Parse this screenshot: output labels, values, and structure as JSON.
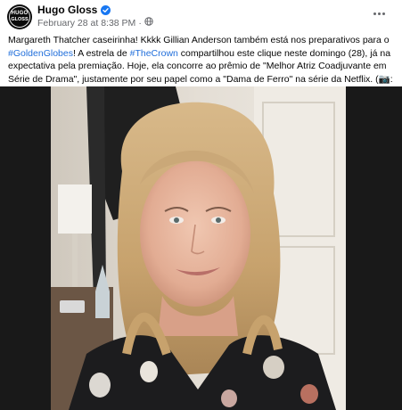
{
  "post": {
    "page_name": "Hugo Gloss",
    "avatar_text_top": "HUGO",
    "avatar_text_bottom": "GLOSS",
    "date": "February 28 at 8:38 PM",
    "separator": "·",
    "privacy_icon": "globe-icon",
    "more_icon": "more-options-icon",
    "caption": {
      "p1": "Margareth Thatcher caseirinha! Kkkk Gillian Anderson também está nos preparativos para o ",
      "tag1": "#GoldenGlobes",
      "p2": "! A estrela de ",
      "tag2": "#TheCrown",
      "p3": " compartilhou este clique neste domingo (28), já na expectativa pela premiação. Hoje, ela concorre ao prêmio de \"Melhor Atriz Coadjuvante em Série de Drama\", justamente por seu papel como a \"Dama de Ferro\" na série da Netflix. (📷: @gilliana)"
    },
    "colors": {
      "link": "#216fdb",
      "verified": "#1877f2",
      "meta_text": "#65676b"
    }
  }
}
